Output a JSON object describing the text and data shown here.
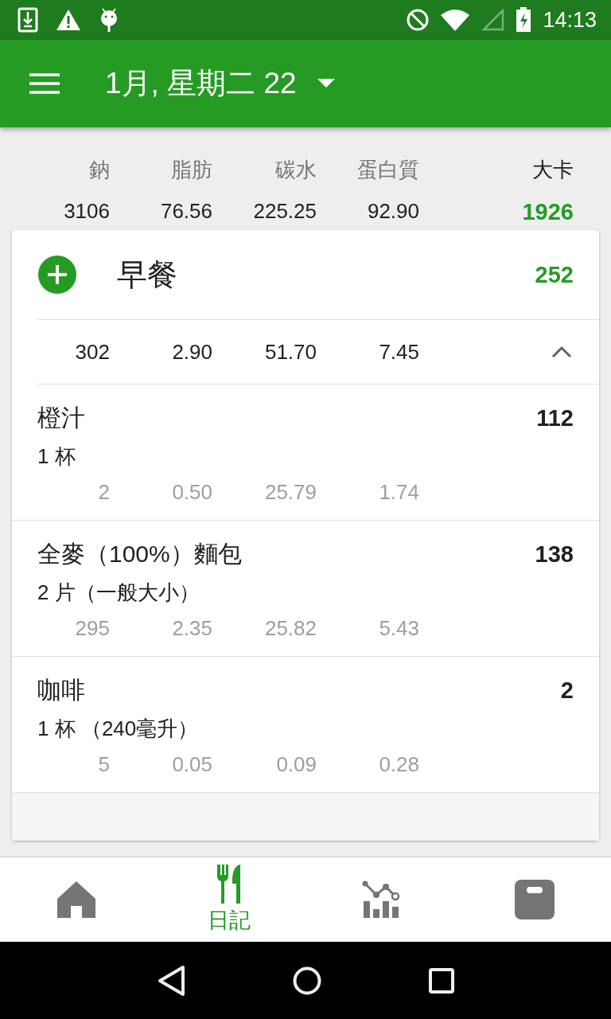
{
  "status_bar": {
    "time": "14:13"
  },
  "app_bar": {
    "title": "1月, 星期二 22"
  },
  "summary": {
    "nutrients": [
      {
        "label": "鈉",
        "value": "3106"
      },
      {
        "label": "脂肪",
        "value": "76.56"
      },
      {
        "label": "碳水",
        "value": "225.25"
      },
      {
        "label": "蛋白質",
        "value": "92.90"
      }
    ],
    "calories": {
      "label": "大卡",
      "value": "1926"
    }
  },
  "meals": [
    {
      "name": "早餐",
      "calories": "252",
      "expanded": true,
      "totals": [
        "302",
        "2.90",
        "51.70",
        "7.45"
      ],
      "items": [
        {
          "name": "橙汁",
          "serving": "1 杯",
          "calories": "112",
          "nutrients": [
            "2",
            "0.50",
            "25.79",
            "1.74"
          ]
        },
        {
          "name": "全麥（100%）麵包",
          "serving": "2 片（一般大小）",
          "calories": "138",
          "nutrients": [
            "295",
            "2.35",
            "25.82",
            "5.43"
          ]
        },
        {
          "name": "咖啡",
          "serving": "1 杯 （240毫升）",
          "calories": "2",
          "nutrients": [
            "5",
            "0.05",
            "0.09",
            "0.28"
          ]
        }
      ]
    }
  ],
  "bottom_nav": [
    {
      "kind": "home",
      "selected": false
    },
    {
      "kind": "diary",
      "label": "日記",
      "selected": true
    },
    {
      "kind": "stats",
      "selected": false
    },
    {
      "kind": "scale",
      "selected": false
    }
  ]
}
